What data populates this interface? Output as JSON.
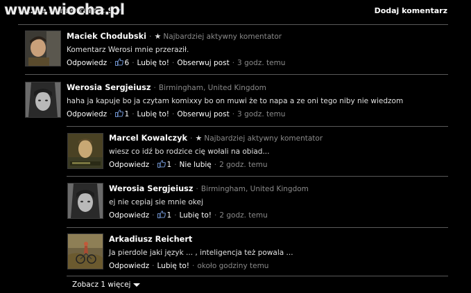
{
  "watermark": "www.wiocha.pl",
  "header": {
    "count_label": "Liczba komentarzy: 9",
    "add_label": "Dodaj komentarz"
  },
  "comments": [
    {
      "author": "Maciek Chodubski",
      "meta": "Najbardziej aktywny komentator",
      "text": "Komentarz Werosi mnie przeraził.",
      "reply": "Odpowiedz",
      "likes": "6",
      "like": "Lubię to!",
      "follow": "Obserwuj post",
      "time": "3 godz. temu"
    },
    {
      "author": "Werosia Sergjeiusz",
      "meta": "Birmingham, United Kingdom",
      "text": "haha ja kapuje bo ja czytam komixxy bo on muwi że to napa a ze oni tego niby nie wiedzom",
      "reply": "Odpowiedz",
      "likes": "1",
      "like": "Lubię to!",
      "follow": "Obserwuj post",
      "time": "3 godz. temu"
    },
    {
      "author": "Marcel Kowalczyk",
      "meta": "Najbardziej aktywny komentator",
      "text": "wiesz co idź bo rodzice cię wołali na obiad...",
      "reply": "Odpowiedz",
      "likes": "1",
      "like": "Nie lubię",
      "time": "2 godz. temu"
    },
    {
      "author": "Werosia Sergjeiusz",
      "meta": "Birmingham, United Kingdom",
      "text": "ej nie cepiaj sie mnie okej",
      "reply": "Odpowiedz",
      "likes": "1",
      "like": "Lubię to!",
      "time": "2 godz. temu"
    },
    {
      "author": "Arkadiusz Reichert",
      "text": "Ja pierdole jaki język ... , inteligencja też powala ...",
      "reply": "Odpowiedz",
      "like": "Lubię to!",
      "time": "około godziny temu"
    }
  ],
  "more_label": "Zobacz 1 więcej"
}
